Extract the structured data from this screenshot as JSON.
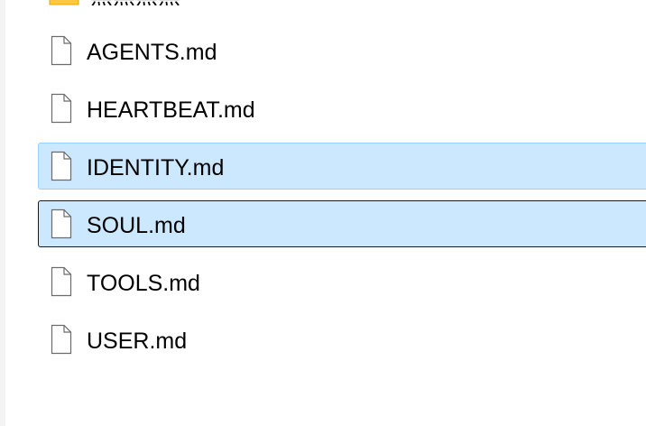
{
  "folder": {
    "name": "黑黑黑黑",
    "icon": "folder-icon"
  },
  "files": [
    {
      "name": "AGENTS.md",
      "icon": "file-icon",
      "selected": false,
      "focused": false,
      "trail": "2"
    },
    {
      "name": "HEARTBEAT.md",
      "icon": "file-icon",
      "selected": false,
      "focused": false,
      "trail": "2"
    },
    {
      "name": "IDENTITY.md",
      "icon": "file-icon",
      "selected": true,
      "focused": false,
      "trail": "2"
    },
    {
      "name": "SOUL.md",
      "icon": "file-icon",
      "selected": true,
      "focused": true,
      "trail": "2"
    },
    {
      "name": "TOOLS.md",
      "icon": "file-icon",
      "selected": false,
      "focused": false,
      "trail": "2"
    },
    {
      "name": "USER.md",
      "icon": "file-icon",
      "selected": false,
      "focused": false,
      "trail": "2"
    }
  ],
  "colors": {
    "selection_bg": "#cce8ff",
    "selection_border": "#99d1ff",
    "focus_border": "#1a1a1a",
    "folder_yellow": "#ffc83d"
  }
}
